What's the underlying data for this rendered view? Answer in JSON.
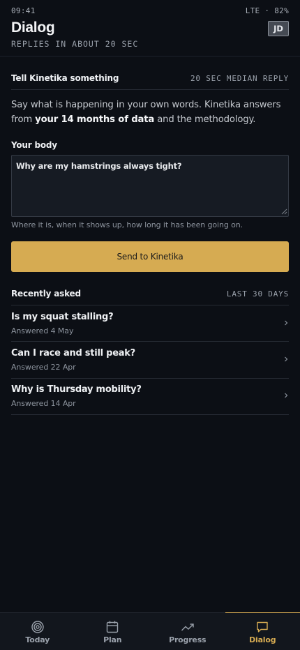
{
  "status": {
    "time": "09:41",
    "network": "LTE · 82%"
  },
  "header": {
    "title": "Dialog",
    "subtitle": "REPLIES IN ABOUT 20 SEC",
    "avatar_initials": "JD"
  },
  "compose": {
    "label": "Tell Kinetika something",
    "meta": "20 SEC MEDIAN REPLY",
    "intro_before": "Say what is happening in your own words. Kinetika answers from ",
    "intro_bold": "your 14 months of data",
    "intro_after": " and the methodology.",
    "field_label": "Your body",
    "field_value": "Why are my hamstrings always tight?",
    "helper": "Where it is, when it shows up, how long it has been going on.",
    "send_label": "Send to Kinetika"
  },
  "recent": {
    "label": "Recently asked",
    "meta": "LAST 30 DAYS",
    "items": [
      {
        "title": "Is my squat stalling?",
        "sub": "Answered 4 May"
      },
      {
        "title": "Can I race and still peak?",
        "sub": "Answered 22 Apr"
      },
      {
        "title": "Why is Thursday mobility?",
        "sub": "Answered 14 Apr"
      }
    ]
  },
  "nav": {
    "items": [
      {
        "label": "Today",
        "icon": "target-icon"
      },
      {
        "label": "Plan",
        "icon": "calendar-icon"
      },
      {
        "label": "Progress",
        "icon": "trend-icon"
      },
      {
        "label": "Dialog",
        "icon": "chat-icon"
      }
    ],
    "active": "Dialog"
  },
  "colors": {
    "accent": "#d6ab52",
    "background": "#0c0f15"
  }
}
